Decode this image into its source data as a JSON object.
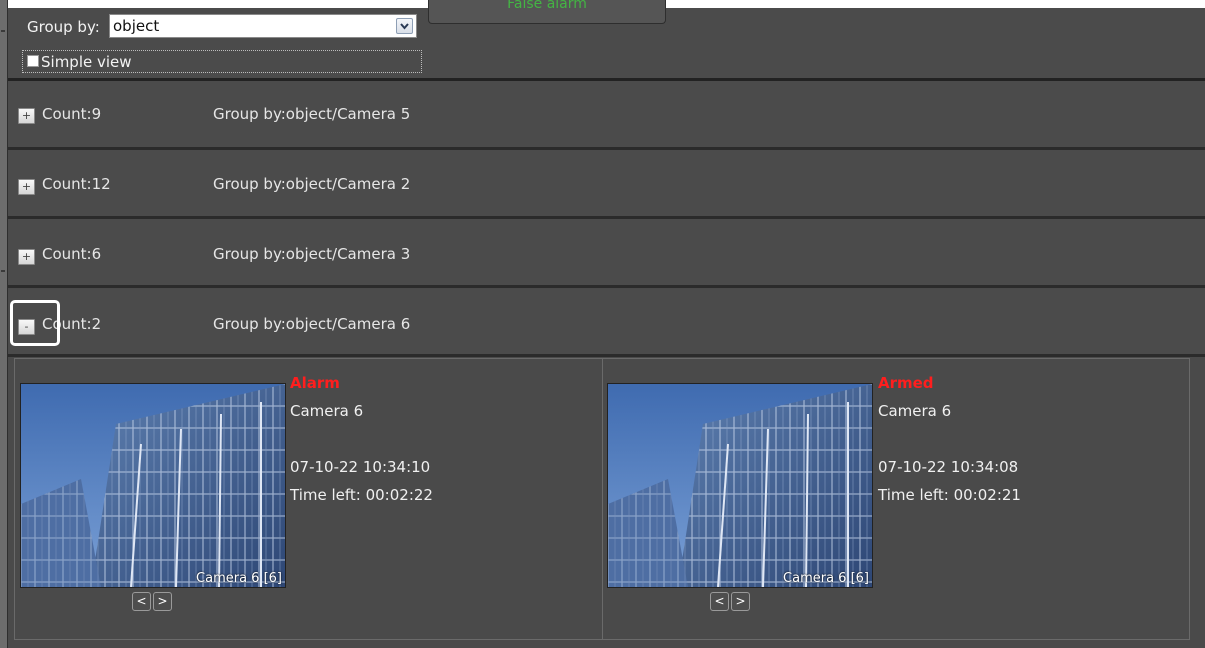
{
  "header": {
    "group_by_label": "Group by:",
    "group_by_value": "object",
    "false_alarm_label": "False alarm",
    "simple_view_label": "Simple view"
  },
  "groups": [
    {
      "expander": "+",
      "count": "Count:9",
      "label": "Group by:object/Camera 5"
    },
    {
      "expander": "+",
      "count": "Count:12",
      "label": "Group by:object/Camera 2"
    },
    {
      "expander": "+",
      "count": "Count:6",
      "label": "Group by:object/Camera 3"
    },
    {
      "expander": "-",
      "count": "Count:2",
      "label": "Group by:object/Camera 6"
    }
  ],
  "cards": [
    {
      "status": "Alarm",
      "camera": "Camera 6",
      "datetime": "07-10-22 10:34:10",
      "time_left": "Time left: 00:02:22",
      "thumb_caption": "Camera 6 [6]",
      "prev": "<",
      "next": ">"
    },
    {
      "status": "Armed",
      "camera": "Camera 6",
      "datetime": "07-10-22 10:34:08",
      "time_left": "Time left: 00:02:21",
      "thumb_caption": "Camera 6 [6]",
      "prev": "<",
      "next": ">"
    }
  ],
  "colors": {
    "status_red": "#ff1e1e",
    "false_alarm_green": "#44b444",
    "panel_bg": "#4b4b4b"
  }
}
